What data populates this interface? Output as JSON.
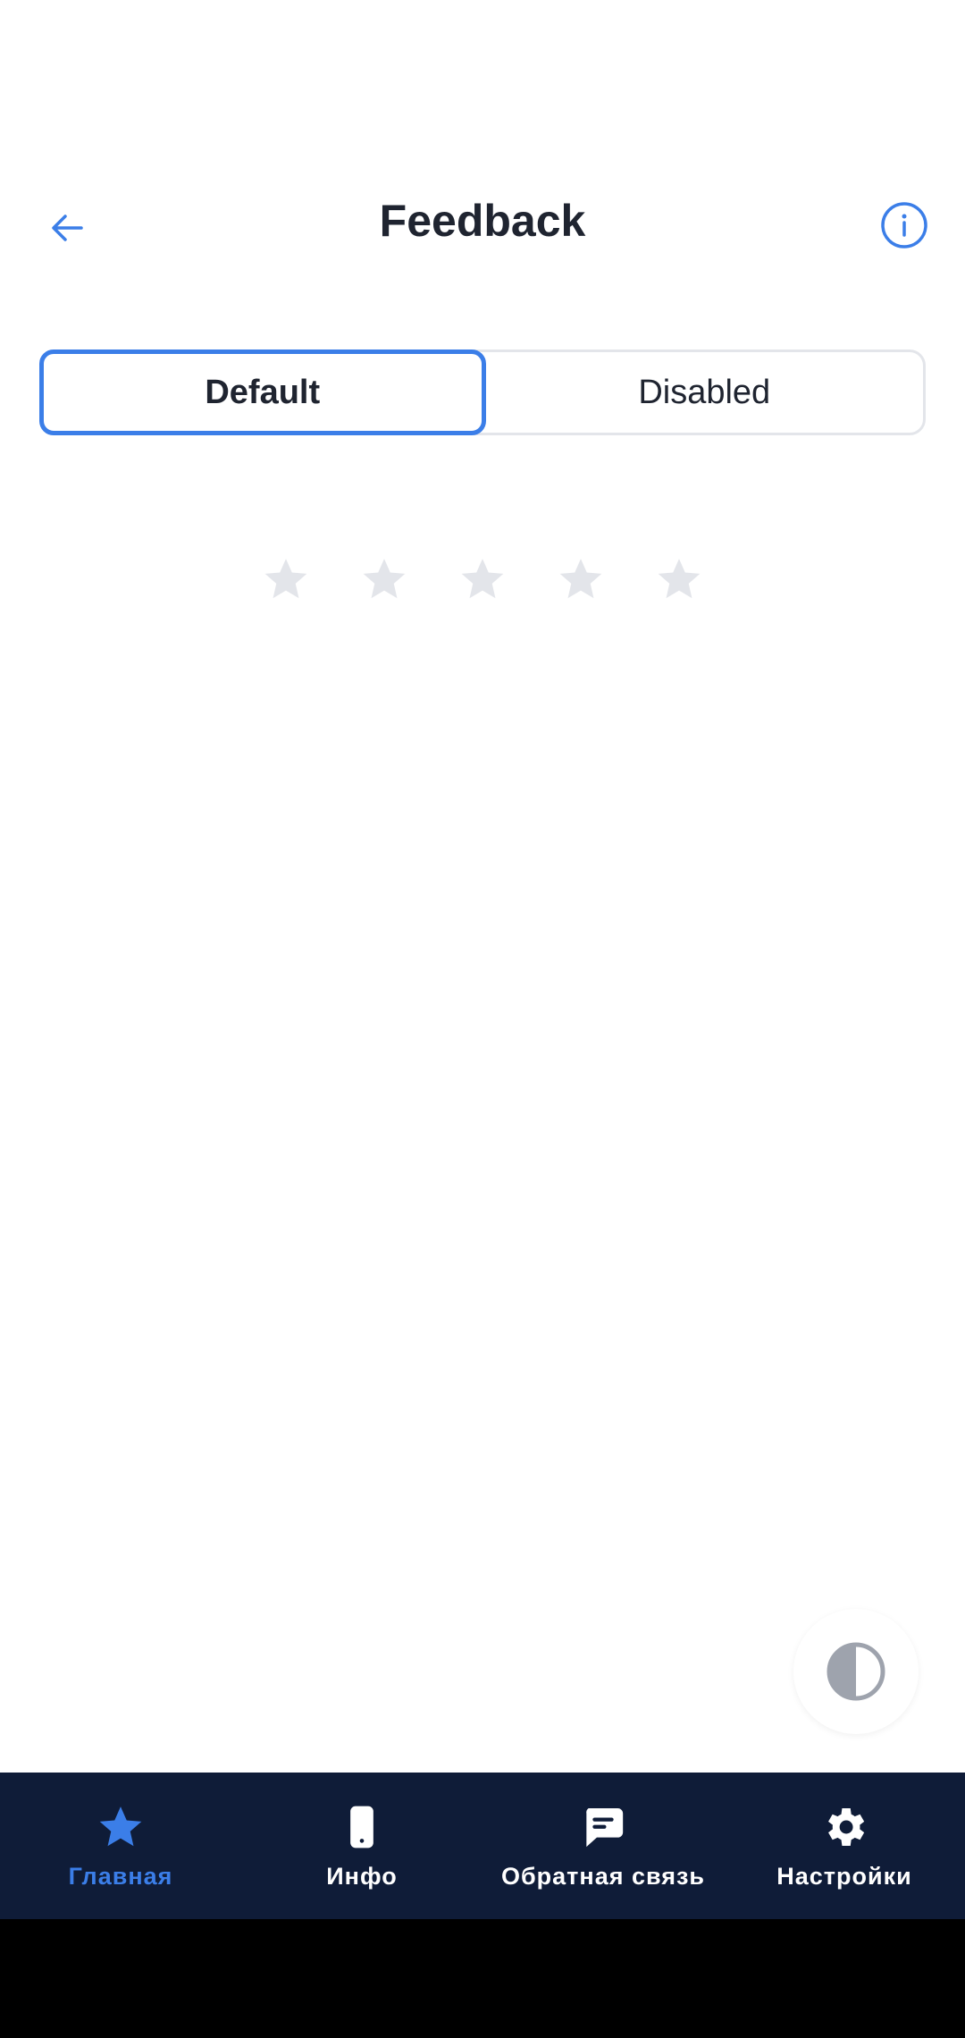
{
  "header": {
    "title": "Feedback",
    "back_icon": "arrow-left-icon",
    "info_icon": "info-circle-icon"
  },
  "tabs": [
    {
      "label": "Default",
      "selected": true
    },
    {
      "label": "Disabled",
      "selected": false
    }
  ],
  "rating": {
    "max": 5,
    "value": 0
  },
  "theme_toggle": {
    "icon": "contrast-icon"
  },
  "bottom_nav": {
    "items": [
      {
        "label": "Главная",
        "icon": "star-icon",
        "active": true
      },
      {
        "label": "Инфо",
        "icon": "phone-icon",
        "active": false
      },
      {
        "label": "Обратная связь",
        "icon": "chat-icon",
        "active": false
      },
      {
        "label": "Настройки",
        "icon": "gear-icon",
        "active": false
      }
    ]
  },
  "colors": {
    "accent": "#3b7ee8",
    "nav_background": "#0f1c38",
    "star_empty": "#e3e5ea",
    "text": "#1f2430"
  }
}
